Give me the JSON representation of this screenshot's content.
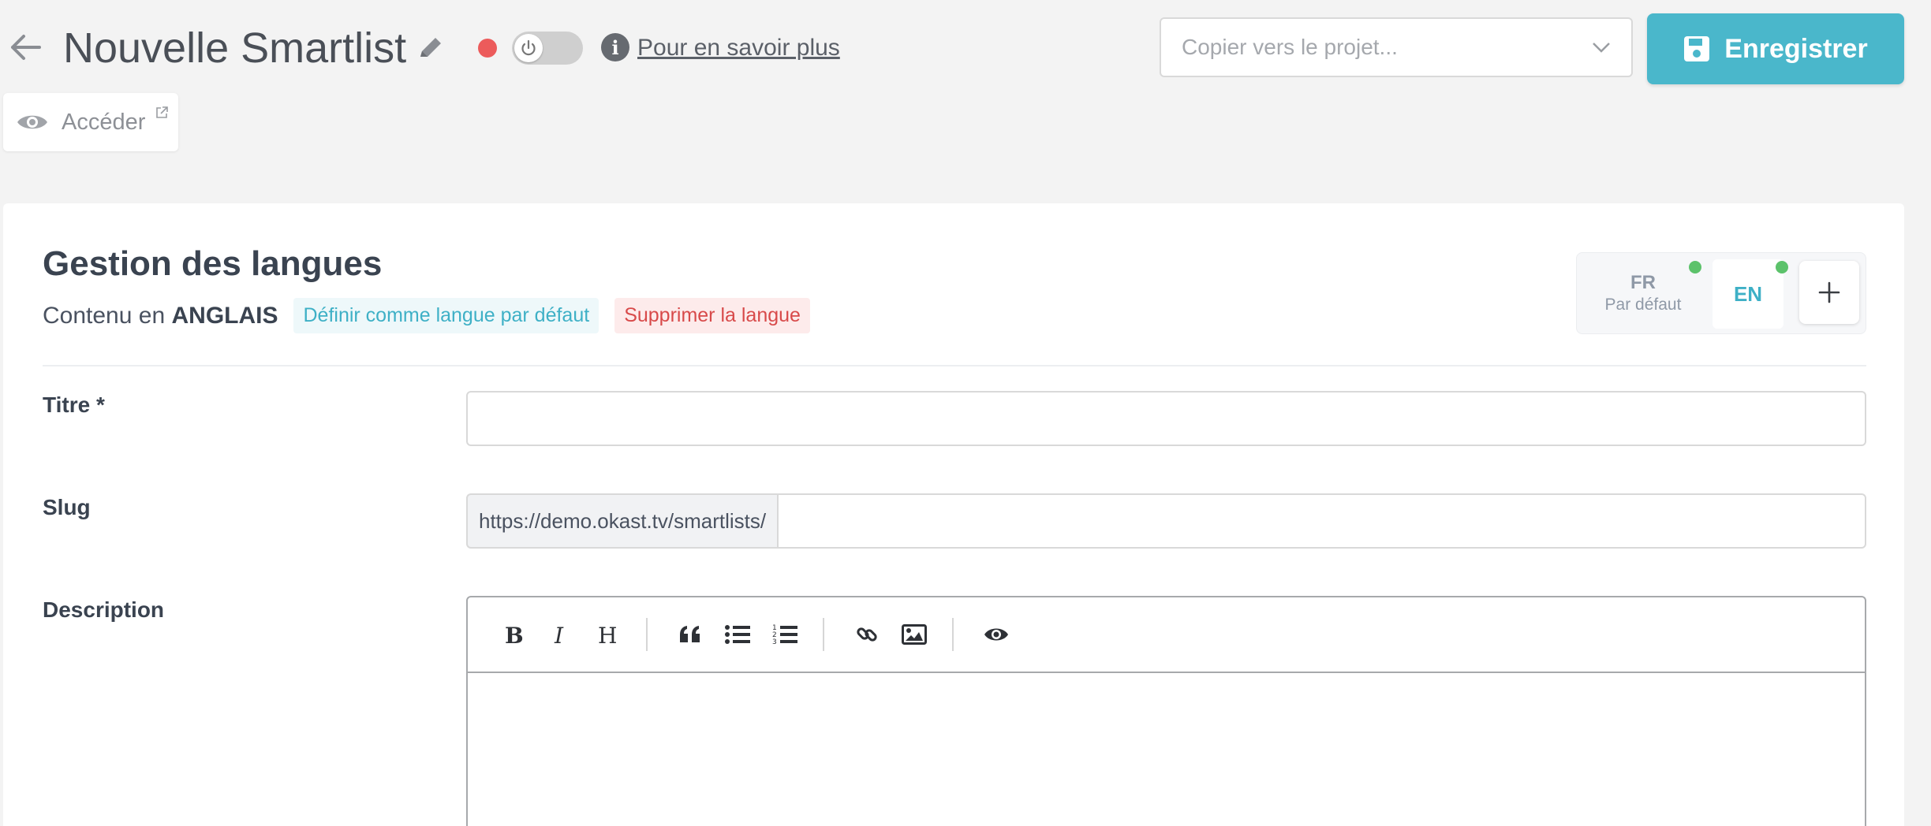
{
  "header": {
    "title": "Nouvelle Smartlist",
    "learn_more": "Pour en savoir plus",
    "copy_placeholder": "Copier vers le projet...",
    "save_label": "Enregistrer",
    "access_label": "Accéder",
    "status_color": "#ec5b5b",
    "toggle_on": false
  },
  "languages": {
    "section_title": "Gestion des langues",
    "content_prefix": "Contenu en",
    "content_language": "ANGLAIS",
    "set_default": "Définir comme langue par défaut",
    "delete_language": "Supprimer la langue",
    "items": [
      {
        "code": "FR",
        "sub": "Par défaut",
        "active": false
      },
      {
        "code": "EN",
        "sub": "",
        "active": true
      }
    ]
  },
  "form": {
    "title_label": "Titre *",
    "title_value": "",
    "slug_label": "Slug",
    "slug_prefix": "https://demo.okast.tv/smartlists/",
    "slug_value": "",
    "description_label": "Description",
    "toolbar_icons": [
      "bold-icon",
      "italic-icon",
      "heading-icon",
      "quote-icon",
      "unordered-list-icon",
      "ordered-list-icon",
      "link-icon",
      "image-icon",
      "preview-icon"
    ]
  },
  "colors": {
    "accent": "#4ab7cb",
    "danger": "#d84a4a",
    "online": "#5cc26b"
  }
}
